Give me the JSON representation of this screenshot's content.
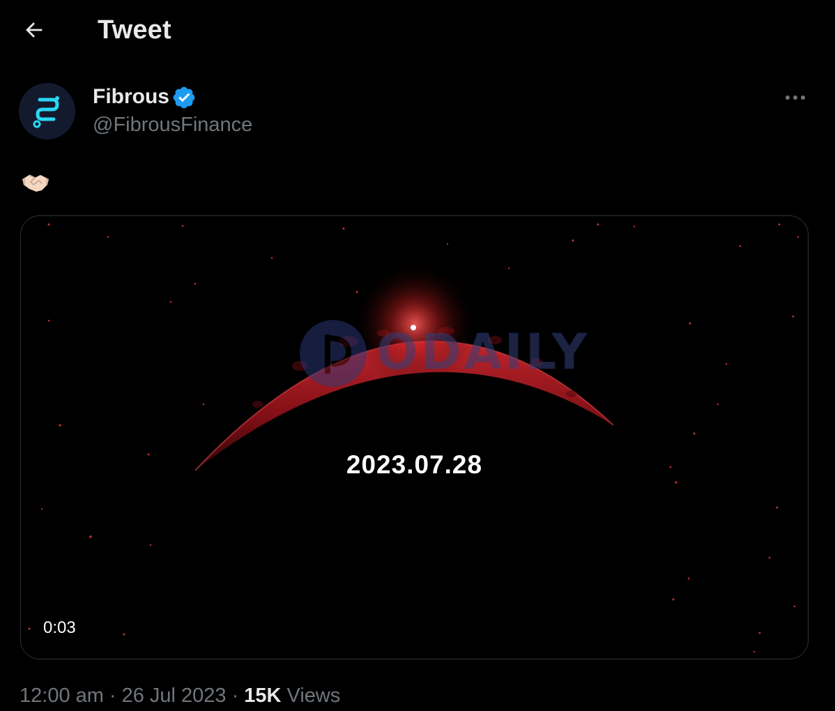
{
  "header": {
    "title": "Tweet",
    "back_icon": "arrow-left-icon"
  },
  "author": {
    "display_name": "Fibrous",
    "handle": "@FibrousFinance",
    "verified": true,
    "avatar_icon": "fibrous-logo-icon",
    "more_icon": "more-horizontal-icon"
  },
  "tweet": {
    "text": "🤝🏻"
  },
  "media": {
    "type": "video",
    "overlay_text": "2023.07.28",
    "duration": "0:03",
    "watermark": "ODAILY"
  },
  "meta": {
    "time": "12:00 am",
    "date": "26 Jul 2023",
    "views_count": "15K",
    "views_label": "Views",
    "separator": "·"
  },
  "colors": {
    "background": "#000000",
    "text_primary": "#e7e9ea",
    "text_secondary": "#71767b",
    "verified_blue": "#1d9bf0",
    "accent_cyan": "#28d7f5",
    "moon_red": "#a3121b"
  }
}
